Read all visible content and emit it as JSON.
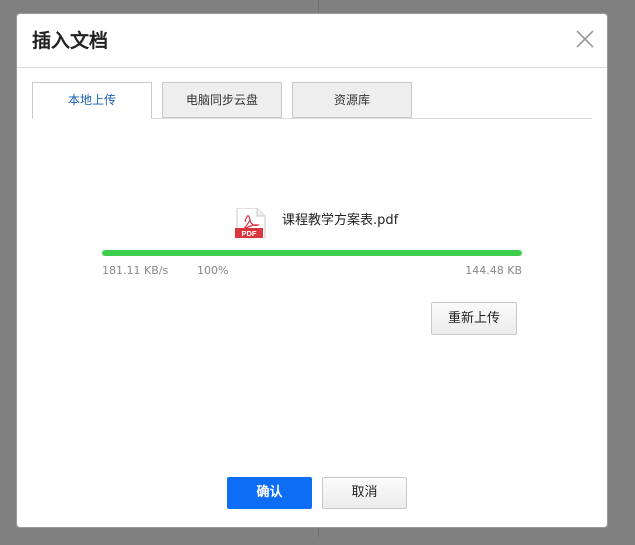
{
  "colors": {
    "accent": "#0d6ef5",
    "progress": "#3ccf4e",
    "active_tab_text": "#1a5fb4",
    "pdf_red": "#d9363e"
  },
  "dialog": {
    "title": "插入文档",
    "close_icon": "close-icon"
  },
  "tabs": [
    {
      "label": "本地上传",
      "active": true
    },
    {
      "label": "电脑同步云盘",
      "active": false
    },
    {
      "label": "资源库",
      "active": false
    }
  ],
  "upload": {
    "file_icon": "pdf-file-icon",
    "file_icon_text": "PDF",
    "file_name": "课程教学方案表.pdf",
    "progress": 1.0,
    "speed": "181.11 KB/s",
    "percent": "100%",
    "size": "144.48 KB",
    "reupload_label": "重新上传"
  },
  "footer": {
    "confirm_label": "确认",
    "cancel_label": "取消"
  }
}
